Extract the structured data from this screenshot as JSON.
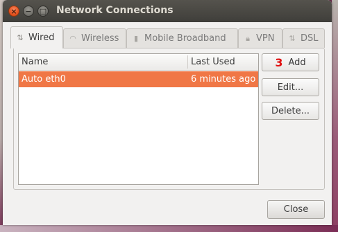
{
  "window": {
    "title": "Network Connections"
  },
  "tabs": [
    {
      "label": "Wired",
      "icon": "wired-icon",
      "active": true
    },
    {
      "label": "Wireless",
      "icon": "wireless-icon",
      "active": false
    },
    {
      "label": "Mobile Broadband",
      "icon": "mobile-broadband-icon",
      "active": false
    },
    {
      "label": "VPN",
      "icon": "vpn-lock-icon",
      "active": false
    },
    {
      "label": "DSL",
      "icon": "dsl-icon",
      "active": false
    }
  ],
  "list": {
    "columns": [
      "Name",
      "Last Used"
    ],
    "rows": [
      {
        "name": "Auto eth0",
        "last_used": "6 minutes ago",
        "selected": true
      }
    ]
  },
  "buttons": {
    "add_badge": "3",
    "add": "Add",
    "edit": "Edit...",
    "delete": "Delete...",
    "close": "Close"
  },
  "colors": {
    "selection": "#f07746",
    "titlebar": "#3f3e3a",
    "badge": "#e01010"
  }
}
